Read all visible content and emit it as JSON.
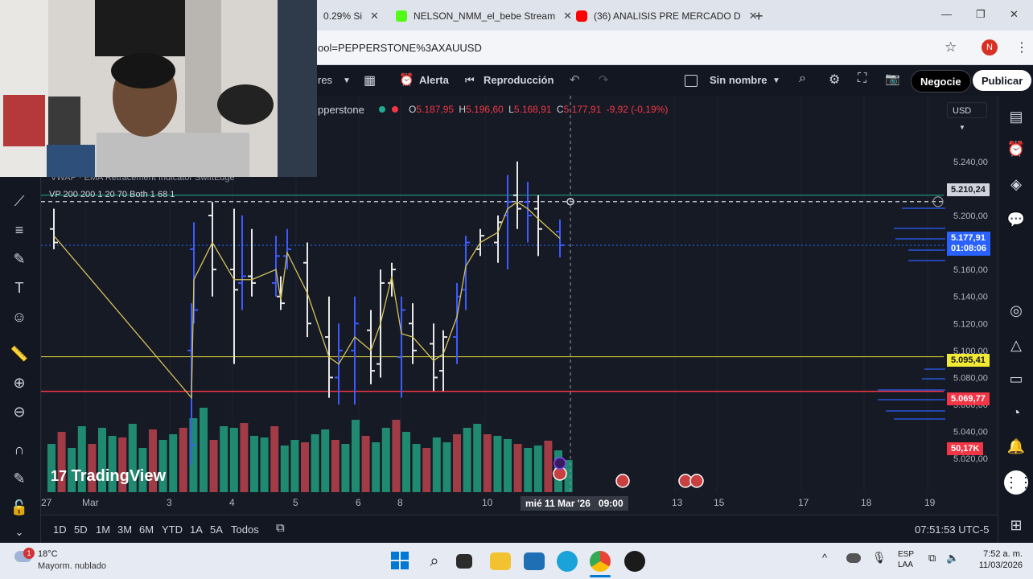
{
  "browser": {
    "tabs": [
      {
        "label": "0.29% Si",
        "partial": true
      },
      {
        "label": "NELSON_NMM_el_bebe Stream"
      },
      {
        "label": "(36) ANALISIS PRE MERCADO D"
      }
    ],
    "new_tab": "+",
    "url": "ool=PEPPERSTONE%3AXAUUSD",
    "profile_initial": "N"
  },
  "toolbar": {
    "indicators": "res",
    "alert": "Alerta",
    "replay": "Reproducción",
    "layout_name": "Sin nombre",
    "trade": "Negocie",
    "publish": "Publicar"
  },
  "legend": {
    "symbol": "pperstone",
    "o_label": "O",
    "o": "5.187,95",
    "h_label": "H",
    "h": "5.196,60",
    "l_label": "L",
    "l": "5.168,91",
    "c_label": "C",
    "c": "5.177,91",
    "change": "-9,92 (-0,19%)",
    "indicator1": "VWAP · EMA Retracement Indicator  SwiftEdge",
    "indicator2": "VP 200 200 1 20 70 Both 1 68 1",
    "currency": "USD"
  },
  "chart_data": {
    "type": "ohlc",
    "symbol": "XAUUSD",
    "ylim": [
      5010,
      5250
    ],
    "y_ticks": [
      "5.240,00",
      "5.220,00",
      "5.200,00",
      "5.180,00",
      "5.160,00",
      "5.140,00",
      "5.120,00",
      "5.100,00",
      "5.080,00",
      "5.060,00",
      "5.040,00",
      "5.020,00"
    ],
    "x_ticks": [
      "27",
      "Mar",
      "3",
      "4",
      "5",
      "6",
      "8",
      "10",
      "13",
      "15",
      "17",
      "18",
      "19"
    ],
    "price_labels": [
      {
        "value": "5.210,24",
        "kind": "crosshair"
      },
      {
        "value": "5.177,91",
        "kind": "last",
        "countdown": "01:08:06"
      },
      {
        "value": "5.095,41",
        "kind": "yellow-line"
      },
      {
        "value": "5.069,77",
        "kind": "red-line"
      },
      {
        "value": "50,17K",
        "kind": "volume"
      }
    ],
    "crosshair_time": "mié 11 Mar '26",
    "crosshair_hour": "09:00",
    "watermark": "TradingView",
    "hlines": [
      {
        "price": 5210.24,
        "color": "#d1d4dc"
      },
      {
        "price": 5177.91,
        "color": "#2962ff"
      },
      {
        "price": 5095.41,
        "color": "#c9c13a"
      },
      {
        "price": 5069.77,
        "color": "#f23645"
      }
    ],
    "bars": [
      {
        "x": "27",
        "o": 5190,
        "h": 5205,
        "l": 5175,
        "c": 5180
      },
      {
        "x": "3",
        "o": 5100,
        "h": 5135,
        "l": 5015,
        "c": 5030
      },
      {
        "x": "3b",
        "o": 5175,
        "h": 5195,
        "l": 5120,
        "c": 5130
      },
      {
        "x": "3c",
        "o": 5200,
        "h": 5210,
        "l": 5140,
        "c": 5160
      },
      {
        "x": "4",
        "o": 5160,
        "h": 5205,
        "l": 5090,
        "c": 5145
      },
      {
        "x": "4b",
        "o": 5150,
        "h": 5200,
        "l": 5130,
        "c": 5155
      },
      {
        "x": "4c",
        "o": 5155,
        "h": 5190,
        "l": 5140,
        "c": 5150
      },
      {
        "x": "5",
        "o": 5150,
        "h": 5185,
        "l": 5140,
        "c": 5170
      },
      {
        "x": "5b",
        "o": 5140,
        "h": 5155,
        "l": 5130,
        "c": 5135
      },
      {
        "x": "5c",
        "o": 5170,
        "h": 5190,
        "l": 5160,
        "c": 5175
      },
      {
        "x": "5d",
        "o": 5165,
        "h": 5180,
        "l": 5110,
        "c": 5120
      },
      {
        "x": "6",
        "o": 5110,
        "h": 5140,
        "l": 5065,
        "c": 5080
      },
      {
        "x": "6b",
        "o": 5080,
        "h": 5120,
        "l": 5060,
        "c": 5100
      },
      {
        "x": "6c",
        "o": 5100,
        "h": 5140,
        "l": 5060,
        "c": 5120
      },
      {
        "x": "6d",
        "o": 5115,
        "h": 5130,
        "l": 5075,
        "c": 5085
      },
      {
        "x": "8",
        "o": 5090,
        "h": 5160,
        "l": 5080,
        "c": 5150
      },
      {
        "x": "8b",
        "o": 5150,
        "h": 5165,
        "l": 5140,
        "c": 5160
      },
      {
        "x": "8c",
        "o": 5095,
        "h": 5140,
        "l": 5065,
        "c": 5130
      },
      {
        "x": "8d",
        "o": 5120,
        "h": 5135,
        "l": 5090,
        "c": 5100
      },
      {
        "x": "8e",
        "o": 5105,
        "h": 5120,
        "l": 5070,
        "c": 5080
      },
      {
        "x": "9",
        "o": 5085,
        "h": 5115,
        "l": 5070,
        "c": 5110
      },
      {
        "x": "9b",
        "o": 5110,
        "h": 5150,
        "l": 5090,
        "c": 5140
      },
      {
        "x": "10",
        "o": 5145,
        "h": 5185,
        "l": 5130,
        "c": 5180
      },
      {
        "x": "10b",
        "o": 5175,
        "h": 5190,
        "l": 5170,
        "c": 5185
      },
      {
        "x": "10c",
        "o": 5180,
        "h": 5200,
        "l": 5165,
        "c": 5195
      },
      {
        "x": "10d",
        "o": 5200,
        "h": 5230,
        "l": 5160,
        "c": 5210
      },
      {
        "x": "10e",
        "o": 5215,
        "h": 5240,
        "l": 5190,
        "c": 5205
      },
      {
        "x": "11",
        "o": 5210,
        "h": 5225,
        "l": 5180,
        "c": 5200
      },
      {
        "x": "11b",
        "o": 5205,
        "h": 5215,
        "l": 5170,
        "c": 5190
      },
      {
        "x": "11c",
        "o": 5188,
        "h": 5197,
        "l": 5169,
        "c": 5178
      }
    ],
    "volumes": [
      60,
      75,
      55,
      82,
      60,
      80,
      70,
      68,
      85,
      55,
      78,
      65,
      72,
      80,
      92,
      105,
      65,
      82,
      80,
      86,
      70,
      68,
      82,
      58,
      65,
      62,
      72,
      78,
      65,
      60,
      90,
      70,
      62,
      80,
      90,
      75,
      60,
      55,
      68,
      62,
      72,
      80,
      85,
      72,
      70,
      66,
      60,
      55,
      58,
      64,
      52,
      40
    ]
  },
  "bottom": {
    "ranges": [
      "1D",
      "5D",
      "1M",
      "3M",
      "6M",
      "YTD",
      "1A",
      "5A",
      "Todos"
    ],
    "clock": "07:51:53 UTC-5"
  },
  "taskbar": {
    "weather_temp": "18°C",
    "weather_desc": "Mayorm. nublado",
    "weather_badge": "1",
    "lang": "ESP",
    "lang2": "LAA",
    "time": "7:52 a. m.",
    "date": "11/03/2026"
  }
}
